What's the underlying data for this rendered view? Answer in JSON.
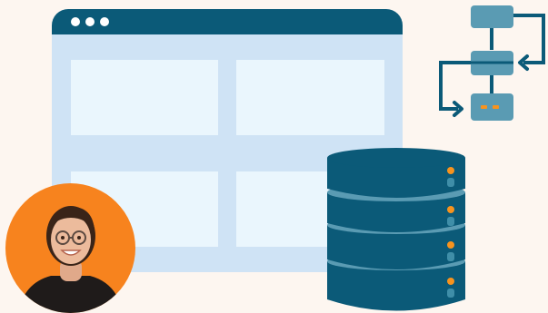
{
  "illustration": {
    "colors": {
      "background": "#fdf6f0",
      "browser_frame": "#cfe3f5",
      "browser_titlebar": "#0b5a78",
      "card_fill": "#eaf6fd",
      "database_dark": "#0b5a78",
      "database_light": "#5a9bb3",
      "indicator_orange": "#f7931e",
      "indicator_teal": "#3f8ea8",
      "flowchart_box": "#5a9bb3",
      "avatar_background": "#f7831e"
    },
    "icons": [
      "browser-window-icon",
      "flowchart-icon",
      "database-icon",
      "person-avatar"
    ]
  }
}
